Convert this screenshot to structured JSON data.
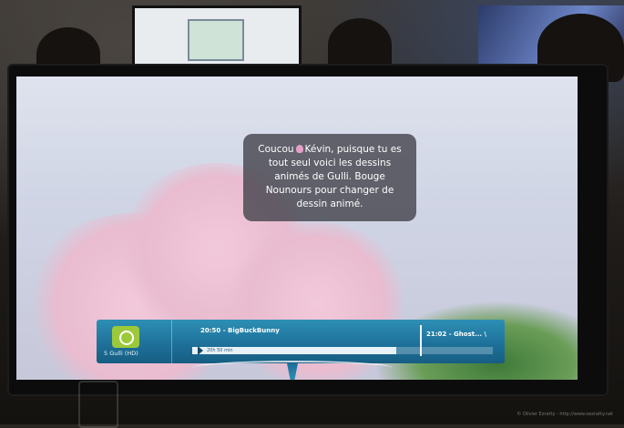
{
  "message": {
    "prefix": "Coucou",
    "avatar_icon": "user-avatar-icon",
    "line1": "Kévin, puisque tu es",
    "line2": "tout seul voici les dessins",
    "line3": "animés de Gulli. Bouge",
    "line4": "Nounours pour changer de",
    "line5": "dessin animé."
  },
  "guide": {
    "channel_name": "5 Gulli (HD)",
    "channel_logo": "gulli-logo-icon",
    "current_program": "20:50 - BigBuckBunny",
    "next_program": "21:02 - Ghost... \\",
    "progress_label": "20h 50 min",
    "progress": 0.68,
    "bar_color": "#1d6f98"
  },
  "watermark": "© Olivier Ezratty - http://www.oezratty.net"
}
